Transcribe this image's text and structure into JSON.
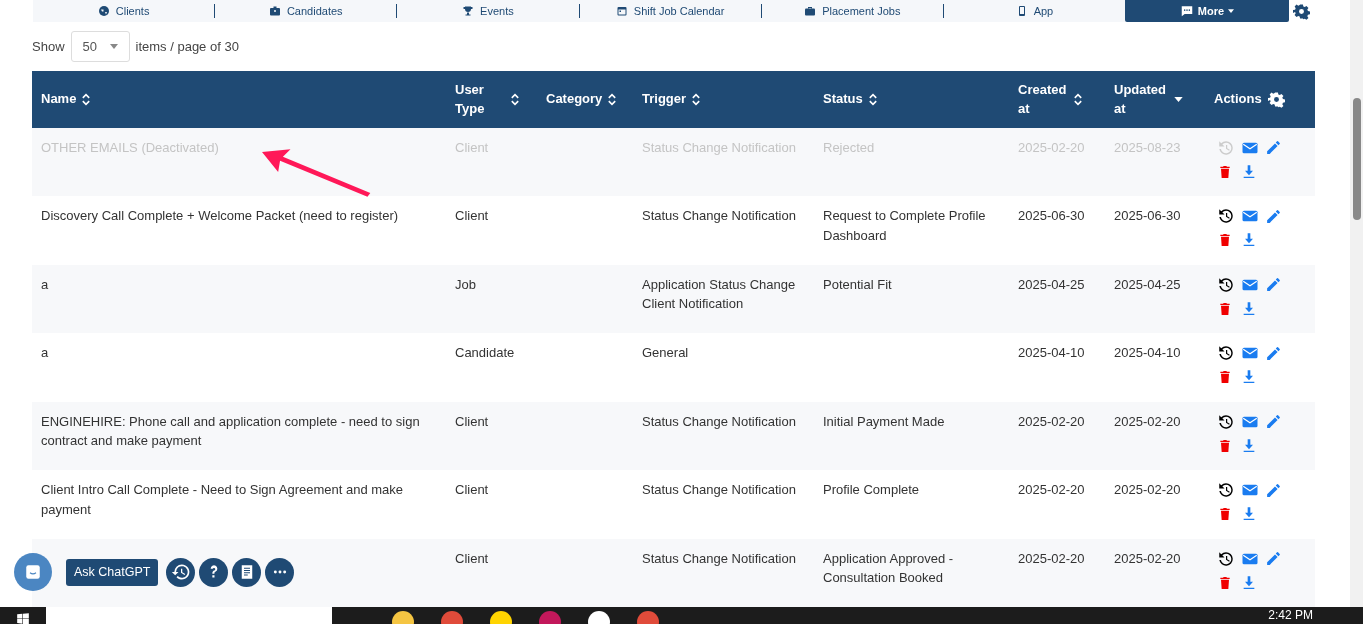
{
  "nav": {
    "items": [
      {
        "label": "Clients",
        "kind": "link"
      },
      {
        "label": "Candidates",
        "kind": "link"
      },
      {
        "label": "Events",
        "kind": "link"
      },
      {
        "label": "Shift Job Calendar",
        "kind": "link"
      },
      {
        "label": "Placement Jobs",
        "kind": "link"
      },
      {
        "label": "App",
        "kind": "link"
      },
      {
        "label": "More",
        "kind": "menu"
      }
    ]
  },
  "pager": {
    "show_label": "Show",
    "per_page": "50",
    "suffix": "items / page of 30"
  },
  "table": {
    "columns": [
      {
        "label": "Name",
        "sortable": true,
        "sorted_desc": false
      },
      {
        "label": "User Type",
        "sortable": true,
        "sorted_desc": false
      },
      {
        "label": "Category",
        "sortable": true,
        "sorted_desc": false
      },
      {
        "label": "Trigger",
        "sortable": true,
        "sorted_desc": false
      },
      {
        "label": "Status",
        "sortable": true,
        "sorted_desc": false
      },
      {
        "label": "Created at",
        "sortable": true,
        "sorted_desc": false
      },
      {
        "label": "Updated at",
        "sortable": true,
        "sorted_desc": true
      },
      {
        "label": "Actions",
        "sortable": false
      }
    ],
    "rows": [
      {
        "name": "OTHER EMAILS (Deactivated)",
        "user_type": "Client",
        "trigger": "Status Change Notification",
        "status": "Rejected",
        "created": "2025-02-20",
        "updated": "2025-08-23",
        "deactivated": true
      },
      {
        "name": "Discovery Call Complete + Welcome Packet (need to register)",
        "user_type": "Client",
        "trigger": "Status Change Notification",
        "status": "Request to Complete Profile Dashboard",
        "created": "2025-06-30",
        "updated": "2025-06-30",
        "deactivated": false
      },
      {
        "name": "a",
        "user_type": "Job",
        "trigger": "Application Status Change Client Notification",
        "status": "Potential Fit",
        "created": "2025-04-25",
        "updated": "2025-04-25",
        "deactivated": false
      },
      {
        "name": "a",
        "user_type": "Candidate",
        "trigger": "General",
        "created": "2025-04-10",
        "updated": "2025-04-10",
        "deactivated": false
      },
      {
        "name": "ENGINEHIRE: Phone call and application complete - need to sign contract and make payment",
        "user_type": "Client",
        "trigger": "Status Change Notification",
        "status": "Initial Payment Made",
        "created": "2025-02-20",
        "updated": "2025-02-20",
        "deactivated": false
      },
      {
        "name": "Client Intro Call Complete - Need to Sign Agreement and make payment",
        "user_type": "Client",
        "trigger": "Status Change Notification",
        "status": "Profile Complete",
        "created": "2025-02-20",
        "updated": "2025-02-20",
        "deactivated": false
      },
      {
        "user_type": "Client",
        "trigger": "Status Change Notification",
        "status": "Application Approved - Consultation Booked",
        "created": "2025-02-20",
        "updated": "2025-02-20",
        "deactivated": false
      }
    ]
  },
  "widgets": {
    "chat_label": "Ask ChatGPT"
  },
  "taskbar": {
    "time": "2:42 PM"
  }
}
